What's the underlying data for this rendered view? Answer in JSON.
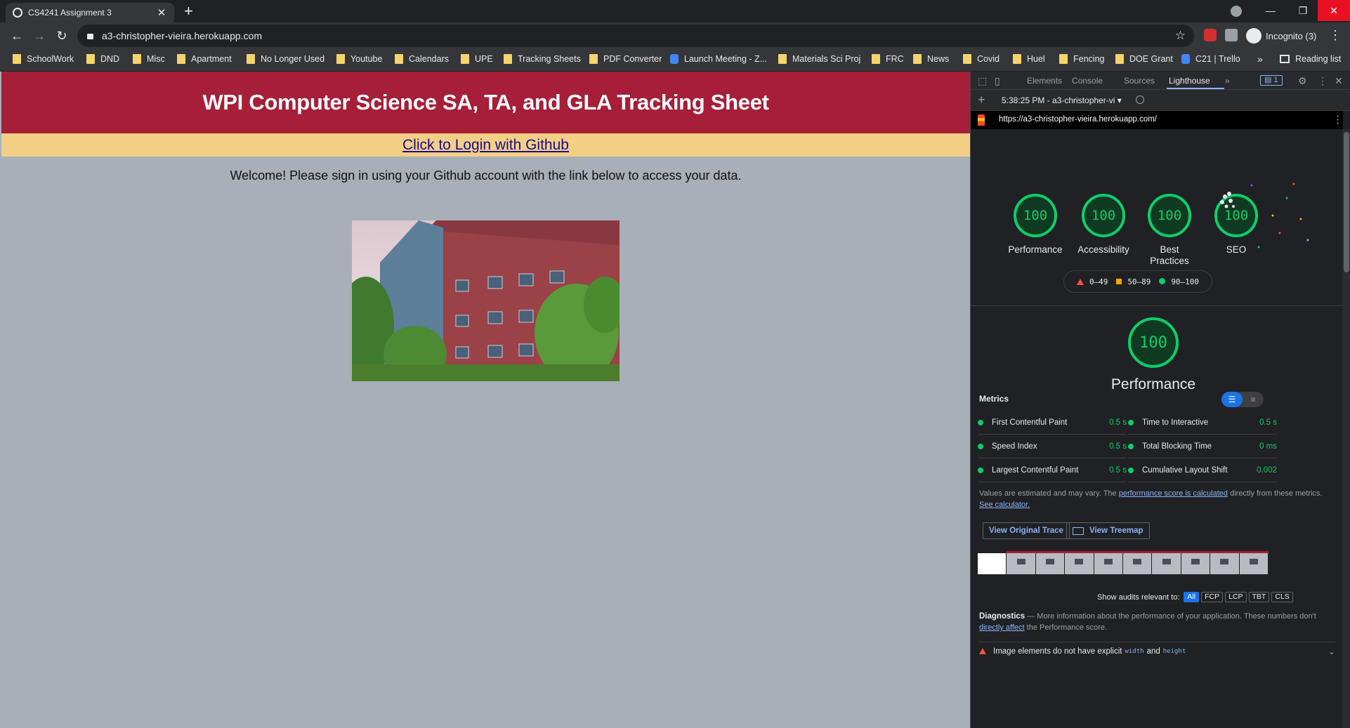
{
  "browser": {
    "tab_title": "CS4241 Assignment 3",
    "tab_close": "✕",
    "new_tab": "+",
    "url": "a3-christopher-vieira.herokuapp.com",
    "profile": "Incognito (3)",
    "window_controls": [
      "—",
      "❐",
      "✕"
    ],
    "nav": {
      "back": "←",
      "forward": "→",
      "reload": "↻"
    },
    "bookmarks": [
      "SchoolWork",
      "DND",
      "Misc",
      "Apartment",
      "No Longer Used",
      "Youtube",
      "Calendars",
      "UPE",
      "Tracking Sheets",
      "PDF Converter",
      "Launch Meeting - Z...",
      "Materials Sci Proj",
      "FRC",
      "News",
      "Covid",
      "Huel",
      "Fencing",
      "DOE Grant",
      "C21 | Trello"
    ],
    "bookmarks_more": "»",
    "reading_list": "Reading list",
    "accent_colors": {
      "folder": "#f6d36b",
      "tab_bg": "#35363a",
      "frame": "#202124"
    }
  },
  "page": {
    "header_title": "WPI Computer Science SA, TA, and GLA Tracking Sheet",
    "login_link": "Click to Login with Github",
    "welcome_text": "Welcome! Please sign in using your Github account with the link below to access your data.",
    "colors": {
      "header": "#a61e38",
      "login_bar": "#f3cf85",
      "body": "#a8afb8"
    }
  },
  "devtools": {
    "tabs": [
      "Elements",
      "Console",
      "Sources",
      "Lighthouse"
    ],
    "active_tab": "Lighthouse",
    "tabs_more": "»",
    "issues_count": "1",
    "report_select": "5:38:25 PM - a3-christopher-vi ▾",
    "report_url": "https://a3-christopher-vieira.herokuapp.com/",
    "scores": [
      {
        "label": "Performance",
        "score": "100"
      },
      {
        "label": "Accessibility",
        "score": "100"
      },
      {
        "label": "Best Practices",
        "score": "100"
      },
      {
        "label": "SEO",
        "score": "100"
      }
    ],
    "legend": [
      "0–49",
      "50–89",
      "90–100"
    ],
    "perf_score": "100",
    "perf_label": "Performance",
    "metrics_title": "Metrics",
    "metrics": [
      {
        "name": "First Contentful Paint",
        "value": "0.5 s"
      },
      {
        "name": "Time to Interactive",
        "value": "0.5 s"
      },
      {
        "name": "Speed Index",
        "value": "0.5 s"
      },
      {
        "name": "Total Blocking Time",
        "value": "0 ms"
      },
      {
        "name": "Largest Contentful Paint",
        "value": "0.5 s"
      },
      {
        "name": "Cumulative Layout Shift",
        "value": "0.002"
      }
    ],
    "note_prefix": "Values are estimated and may vary. The ",
    "note_link": "performance score is calculated",
    "note_mid": " directly from these metrics. ",
    "note_link2": "See calculator.",
    "btn_trace": "View Original Trace",
    "btn_treemap": "View Treemap",
    "filter_label": "Show audits relevant to:",
    "filters": [
      "All",
      "FCP",
      "LCP",
      "TBT",
      "CLS"
    ],
    "diag_title": "Diagnostics",
    "diag_prefix": " — More information about the performance of your application. These numbers don't ",
    "diag_link": "directly affect",
    "diag_suffix": " the Performance score.",
    "audit1_prefix": "Image elements do not have explicit",
    "audit1_code1": "width",
    "audit1_and": "and",
    "audit1_code2": "height",
    "good_color": "#0cce6b"
  }
}
